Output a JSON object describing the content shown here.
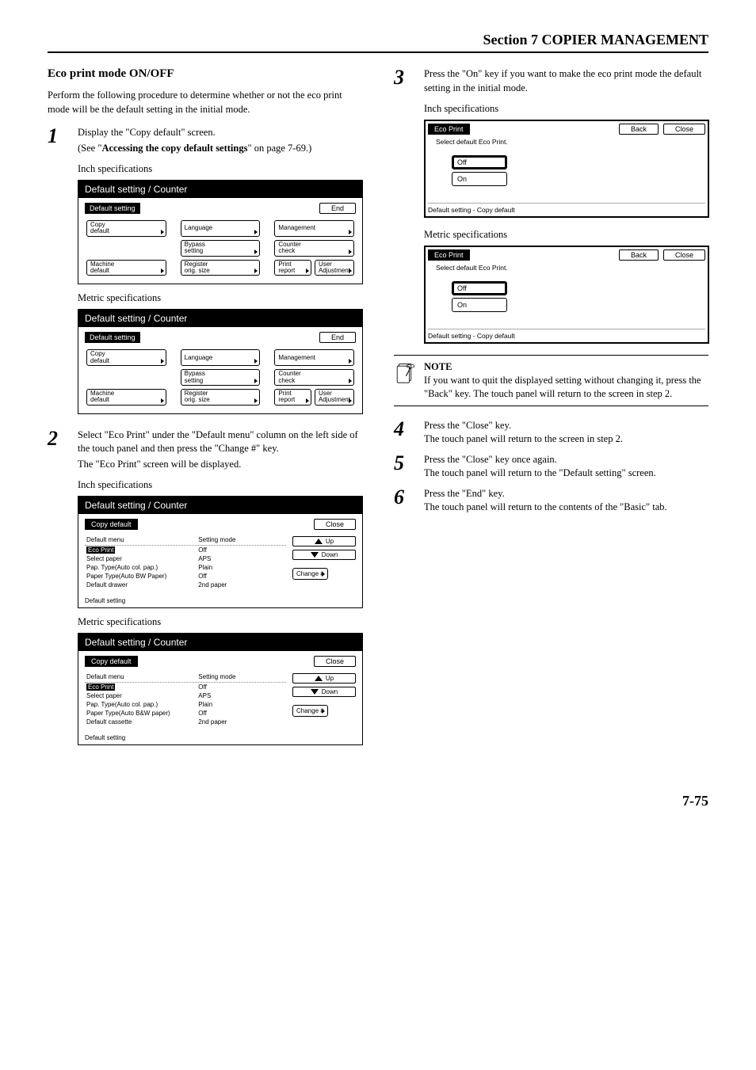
{
  "section_header": "Section 7  COPIER MANAGEMENT",
  "topic_title": "Eco print mode ON/OFF",
  "intro": "Perform the following procedure to determine whether or not the eco print mode will be the default setting in the initial mode.",
  "inch_label": "Inch specifications",
  "metric_label": "Metric specifications",
  "step1_line1": "Display the \"Copy default\" screen.",
  "step1_line2a": "(See \"",
  "step1_line2b": "Accessing the copy default settings",
  "step1_line2c": "\" on page 7-69.)",
  "step2_line1": "Select \"Eco Print\" under the \"Default menu\" column on the left side of the touch panel and then press the \"Change #\" key.",
  "step2_line2": "The \"Eco Print\" screen will be displayed.",
  "step3": "Press the \"On\" key if you want to make the eco print mode the default setting in the initial mode.",
  "step4_line1": "Press the \"Close\" key.",
  "step4_line2": "The touch panel will return to the screen in step 2.",
  "step5_line1": "Press the \"Close\" key once again.",
  "step5_line2": "The touch panel will return to the \"Default setting\" screen.",
  "step6_line1": "Press the \"End\" key.",
  "step6_line2": "The touch panel will return to the contents of the \"Basic\" tab.",
  "note_title": "NOTE",
  "note_body": "If you want to quit the displayed setting without changing it, press the \"Back\" key. The touch panel will return to the screen in step 2.",
  "page_number": "7-75",
  "ds": {
    "title": "Default setting / Counter",
    "tab": "Default setting",
    "end": "End",
    "btns": {
      "copy_default": "Copy\ndefault",
      "language": "Language",
      "management": "Management",
      "bypass_setting": "Bypass\nsetting",
      "counter_check": "Counter\ncheck",
      "machine_default": "Machine\ndefault",
      "register_orig_size": "Register\norig. size",
      "print_report": "Print\nreport",
      "user_adjustment": "User\nAdjustment"
    }
  },
  "cd_inch": {
    "title": "Default setting / Counter",
    "tab": "Copy default",
    "close": "Close",
    "head1": "Default menu",
    "head2": "Setting mode",
    "rows": [
      {
        "menu": "Eco Print",
        "mode": "Off",
        "sel": true
      },
      {
        "menu": "Select paper",
        "mode": "APS"
      },
      {
        "menu": "Pap. Type(Auto col. pap.)",
        "mode": "Plain"
      },
      {
        "menu": "Paper Type(Auto BW Paper)",
        "mode": "Off"
      },
      {
        "menu": "Default drawer",
        "mode": "2nd paper"
      }
    ],
    "up": "Up",
    "down": "Down",
    "change": "Change #",
    "footer": "Default setting"
  },
  "cd_metric": {
    "title": "Default setting / Counter",
    "tab": "Copy default",
    "close": "Close",
    "head1": "Default menu",
    "head2": "Setting mode",
    "rows": [
      {
        "menu": "Eco Print",
        "mode": "Off",
        "sel": true
      },
      {
        "menu": "Select paper",
        "mode": "APS"
      },
      {
        "menu": "Pap. Type(Auto col. pap.)",
        "mode": "Plain"
      },
      {
        "menu": "Paper Type(Auto B&W paper)",
        "mode": "Off"
      },
      {
        "menu": "Default cassette",
        "mode": "2nd paper"
      }
    ],
    "up": "Up",
    "down": "Down",
    "change": "Change #",
    "footer": "Default setting"
  },
  "ep": {
    "tab": "Eco Print",
    "back": "Back",
    "close": "Close",
    "msg": "Select default Eco Print.",
    "off": "Off",
    "on": "On",
    "footer": "Default setting - Copy default"
  }
}
